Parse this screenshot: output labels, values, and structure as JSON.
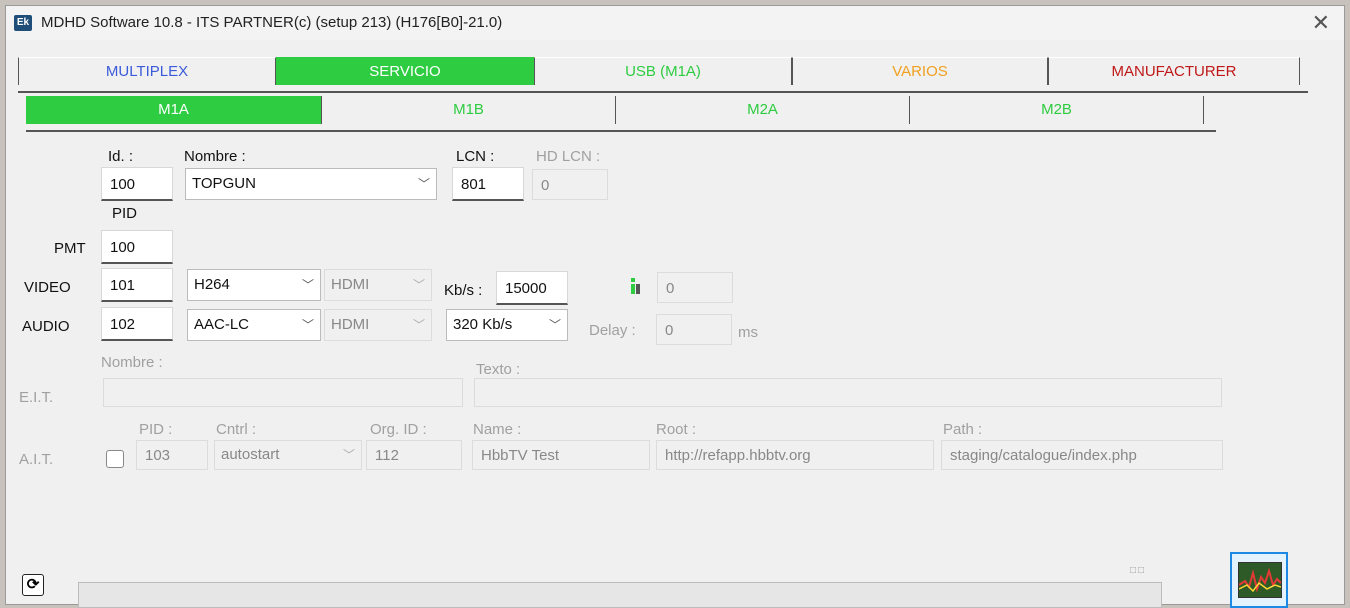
{
  "window": {
    "title": "MDHD Software 10.8 - ITS PARTNER(c) (setup 213) (H176[B0]-21.0)",
    "icon_text": "Ek"
  },
  "main_tabs": [
    {
      "label": "MULTIPLEX",
      "color": "#3b5bdb"
    },
    {
      "label": "SERVICIO",
      "color": "#ffffff"
    },
    {
      "label": "USB (M1A)",
      "color": "#2ecc40"
    },
    {
      "label": "VARIOS",
      "color": "#f0a020"
    },
    {
      "label": "MANUFACTURER",
      "color": "#c01818"
    }
  ],
  "sub_tabs": [
    {
      "label": "M1A"
    },
    {
      "label": "M1B"
    },
    {
      "label": "M2A"
    },
    {
      "label": "M2B"
    }
  ],
  "service": {
    "id_label": "Id. :",
    "id_value": "100",
    "nombre_label": "Nombre :",
    "nombre_value": "TOPGUN",
    "lcn_label": "LCN :",
    "lcn_value": "801",
    "hdlcn_label": "HD LCN :",
    "hdlcn_value": "0",
    "pid_label": "PID"
  },
  "pmt": {
    "label": "PMT",
    "value": "100"
  },
  "video": {
    "label": "VIDEO",
    "pid": "101",
    "codec": "H264",
    "source": "HDMI",
    "kbs_label": "Kb/s :",
    "kbs_value": "15000",
    "extra_value": "0"
  },
  "audio": {
    "label": "AUDIO",
    "pid": "102",
    "codec": "AAC-LC",
    "source": "HDMI",
    "bitrate": "320  Kb/s",
    "delay_label": "Delay :",
    "delay_value": "0",
    "delay_unit": "ms"
  },
  "eit": {
    "label": "E.I.T.",
    "nombre_label": "Nombre :",
    "nombre_value": "",
    "texto_label": "Texto :",
    "texto_value": ""
  },
  "ait": {
    "label": "A.I.T.",
    "pid_label": "PID :",
    "pid_value": "103",
    "cntrl_label": "Cntrl :",
    "cntrl_value": "autostart",
    "orgid_label": "Org. ID :",
    "orgid_value": "112",
    "name_label": "Name :",
    "name_value": "HbbTV Test",
    "root_label": "Root :",
    "root_value": "http://refapp.hbbtv.org",
    "path_label": "Path :",
    "path_value": "staging/catalogue/index.php"
  },
  "footer": {
    "refresh_icon": "refresh-icon",
    "progress": 0,
    "monitor_icon": "monitor-chart-icon",
    "tiny_squares": "□□"
  }
}
